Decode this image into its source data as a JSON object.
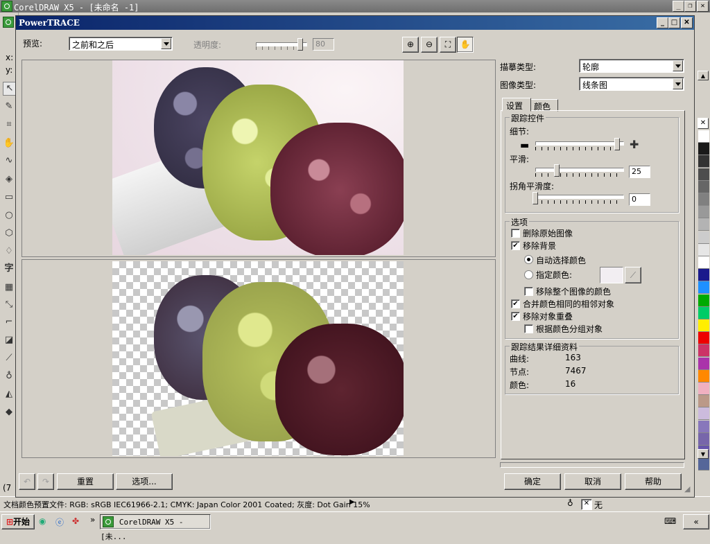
{
  "app": {
    "window_title": "CorelDRAW X5 - [未命名 -1]",
    "coord_x": "x:",
    "coord_y": "y:",
    "left_cut": "(7"
  },
  "dialog": {
    "title": "PowerTRACE",
    "preview_label": "预览:",
    "preview_value": "之前和之后",
    "transparency_label": "透明度:",
    "transparency_value": "80",
    "trace_type_label": "描摹类型:",
    "trace_type_value": "轮廓",
    "image_type_label": "图像类型:",
    "image_type_value": "线条图",
    "tabs": [
      "设置",
      "颜色"
    ],
    "trace_controls": {
      "title": "跟踪控件",
      "detail_label": "细节:",
      "smoothing_label": "平滑:",
      "smoothing_value": "25",
      "corner_label": "拐角平滑度:",
      "corner_value": "0"
    },
    "options": {
      "title": "选项",
      "delete_original": "删除原始图像",
      "remove_background": "移除背景",
      "auto_color": "自动选择颜色",
      "specify_color": "指定颜色:",
      "remove_whole_image_color": "移除整个图像的颜色",
      "merge_adjacent": "合并颜色相同的相邻对象",
      "remove_overlap": "移除对象重叠",
      "group_by_color": "根据颜色分组对象"
    },
    "results": {
      "title": "跟踪结果详细资料",
      "curves_label": "曲线:",
      "curves_value": "163",
      "nodes_label": "节点:",
      "nodes_value": "7467",
      "colors_label": "颜色:",
      "colors_value": "16"
    },
    "buttons": {
      "reset": "重置",
      "options": "选项...",
      "ok": "确定",
      "cancel": "取消",
      "help": "帮助"
    }
  },
  "status": {
    "text": "文档颜色预置文件: RGB: sRGB IEC61966-2.1; CMYK: Japan Color 2001 Coated; 灰度: Dot Gain 15%",
    "fill_none": "无"
  },
  "taskbar": {
    "start": "开始",
    "task": "CorelDRAW X5 - [未..."
  },
  "palette_colors": [
    "#ffffff",
    "#1a1a1a",
    "#333333",
    "#4d4d4d",
    "#666666",
    "#808080",
    "#999999",
    "#b3b3b3",
    "#cccccc",
    "#e6e6e6",
    "#ffffff",
    "#1a1a8c",
    "#1e90ff",
    "#00aa00",
    "#00cc66",
    "#ffee00",
    "#ee0000",
    "#cc3366",
    "#aa33aa",
    "#ff8800",
    "#f0b0c0",
    "#bb9988",
    "#ccbbdd",
    "#8877bb",
    "#7766aa",
    "#6655aa",
    "#556699"
  ]
}
